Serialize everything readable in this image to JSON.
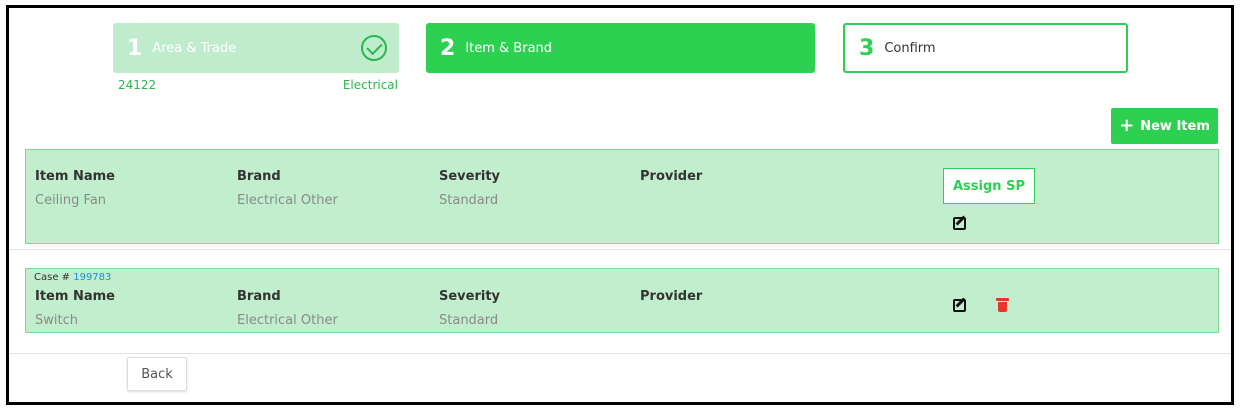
{
  "stepper": {
    "steps": [
      {
        "number": "1",
        "label": "Area & Trade",
        "state": "completed"
      },
      {
        "number": "2",
        "label": "Item & Brand",
        "state": "active"
      },
      {
        "number": "3",
        "label": "Confirm",
        "state": "upcoming"
      }
    ],
    "step1_area": "24122",
    "step1_trade": "Electrical"
  },
  "toolbar": {
    "new_item_label": "New Item",
    "new_item_icon": "plus-icon"
  },
  "items": [
    {
      "case_prefix": "",
      "case_number": "",
      "headers": {
        "item_name": "Item Name",
        "brand": "Brand",
        "severity": "Severity",
        "provider": "Provider"
      },
      "item_name": "Ceiling Fan",
      "brand": "Electrical Other",
      "severity": "Standard",
      "provider": "",
      "assign_label": "Assign SP"
    },
    {
      "case_prefix": "Case # ",
      "case_number": "199783",
      "headers": {
        "item_name": "Item Name",
        "brand": "Brand",
        "severity": "Severity",
        "provider": "Provider"
      },
      "item_name": "Switch",
      "brand": "Electrical Other",
      "severity": "Standard",
      "provider": ""
    }
  ],
  "footer": {
    "back_label": "Back"
  },
  "colors": {
    "accent": "#2ed052",
    "completed_bg": "#bfeccc",
    "card_bg": "#c1eecc",
    "link": "#1a8fd0",
    "delete": "#e8362c"
  }
}
